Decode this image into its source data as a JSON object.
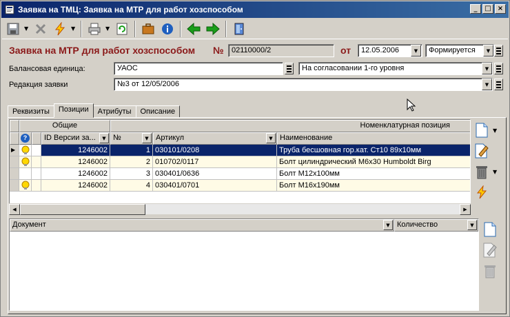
{
  "window": {
    "title": "Заявка на ТМЦ: Заявка на МТР для работ хозспособом",
    "min_label": "_",
    "max_label": "□",
    "close_label": "×"
  },
  "header": {
    "doc_title": "Заявка на МТР для работ хозспособом",
    "number_label": "№",
    "number_value": "02110000/2",
    "date_label": "от",
    "date_value": "12.05.2006",
    "status_value": "Формируется"
  },
  "form": {
    "balance_label": "Балансовая единица:",
    "balance_value": "УАОС",
    "approval_value": "На согласовании 1-го уровня",
    "revision_label": "Редакция заявки",
    "revision_value": "№3 от 12/05/2006"
  },
  "tabs": [
    {
      "label": "Реквизиты"
    },
    {
      "label": "Позиции"
    },
    {
      "label": "Атрибуты"
    },
    {
      "label": "Описание"
    }
  ],
  "grid": {
    "group_general": "Общие",
    "group_nomen": "Номенклатурная позиция",
    "col_version": "ID Версии за...",
    "col_num": "№",
    "col_article": "Артикул",
    "col_name": "Наименование",
    "help_glyph": "?",
    "rows": [
      {
        "version": "1246002",
        "num": "1",
        "article": "030101/0208",
        "name": "Труба бесшовная гор.кат. Ст10 89х10мм",
        "bulb": true,
        "selected": true
      },
      {
        "version": "1246002",
        "num": "2",
        "article": "010702/0117",
        "name": "Болт цилиндрический М6х30 Humboldt Birg",
        "bulb": true,
        "selected": false
      },
      {
        "version": "1246002",
        "num": "3",
        "article": "030401/0636",
        "name": "Болт М12х100мм",
        "bulb": false,
        "selected": false
      },
      {
        "version": "1246002",
        "num": "4",
        "article": "030401/0701",
        "name": "Болт М16х190мм",
        "bulb": true,
        "selected": false
      }
    ]
  },
  "grid2": {
    "col_document": "Документ",
    "col_quantity": "Количество"
  },
  "colors": {
    "title_red": "#8b1a1a",
    "selection": "#0a246a",
    "bulb": "#ffd800",
    "green_arrow": "#1a9e1a"
  }
}
